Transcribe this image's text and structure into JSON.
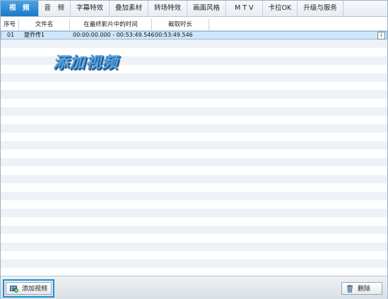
{
  "tabs": [
    "视　频",
    "音　频",
    "字幕特效",
    "叠加素材",
    "转场特效",
    "画面风格",
    "M T V",
    "卡拉OK",
    "升级与服务"
  ],
  "table": {
    "headers": [
      "序号",
      "文件名",
      "在最终影片中的时间",
      "截取时长"
    ],
    "rows": [
      {
        "index": "01",
        "filename": "楚乔传1",
        "timeline": "00:00:00.000 - 00:53:49.546",
        "duration": "00:53:49.546"
      }
    ],
    "info_button": "i"
  },
  "watermark": "添加视频",
  "colors": {
    "accent": "#1d78c7",
    "selected_row": "#cfe6fb",
    "highlight_border": "#1a8fd8"
  },
  "bottom": {
    "add_video_label": "添加视频",
    "delete_label": "删除",
    "add_icon": "film-add-icon",
    "delete_icon": "trash-icon"
  }
}
